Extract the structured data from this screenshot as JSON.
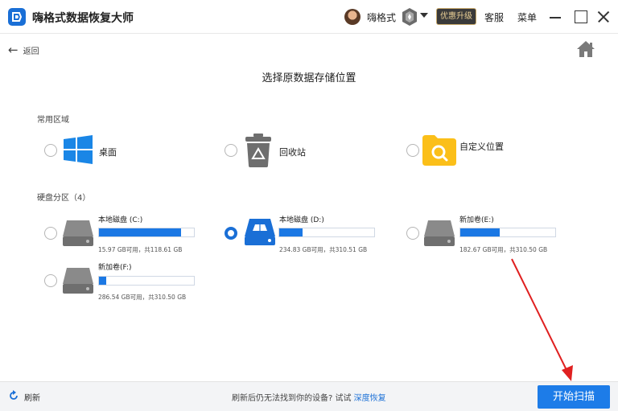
{
  "titlebar": {
    "app_title": "嗨格式数据恢复大师",
    "username": "嗨格式",
    "upgrade_label": "优惠升级",
    "service_label": "客服",
    "menu_label": "菜单"
  },
  "nav": {
    "back_label": "返回"
  },
  "page_title": "选择原数据存储位置",
  "common": {
    "section_label": "常用区域",
    "items": [
      {
        "label": "桌面",
        "icon": "windows-desktop-icon"
      },
      {
        "label": "回收站",
        "icon": "recycle-bin-icon"
      },
      {
        "label": "自定义位置",
        "icon": "folder-search-icon"
      }
    ]
  },
  "disks": {
    "section_label": "硬盘分区（4）",
    "items": [
      {
        "name": "本地磁盘 (C:)",
        "info": "15.97 GB可用，共118.61 GB",
        "used_fraction": 0.865,
        "selected": false
      },
      {
        "name": "本地磁盘 (D:)",
        "info": "234.83 GB可用，共310.51 GB",
        "used_fraction": 0.244,
        "selected": true
      },
      {
        "name": "新加卷(E:)",
        "info": "182.67 GB可用，共310.50 GB",
        "used_fraction": 0.412,
        "selected": false
      },
      {
        "name": "新加卷(F:)",
        "info": "286.54 GB可用，共310.50 GB",
        "used_fraction": 0.077,
        "selected": false
      }
    ]
  },
  "bottom": {
    "refresh_label": "刷新",
    "hint_text": "刷新后仍无法找到你的设备? 试试 ",
    "hint_link": "深度恢复",
    "start_button": "开始扫描"
  },
  "colors": {
    "accent": "#1d7ce8",
    "bar_fill": "#1b78e4",
    "annotation_arrow": "#e02020"
  }
}
